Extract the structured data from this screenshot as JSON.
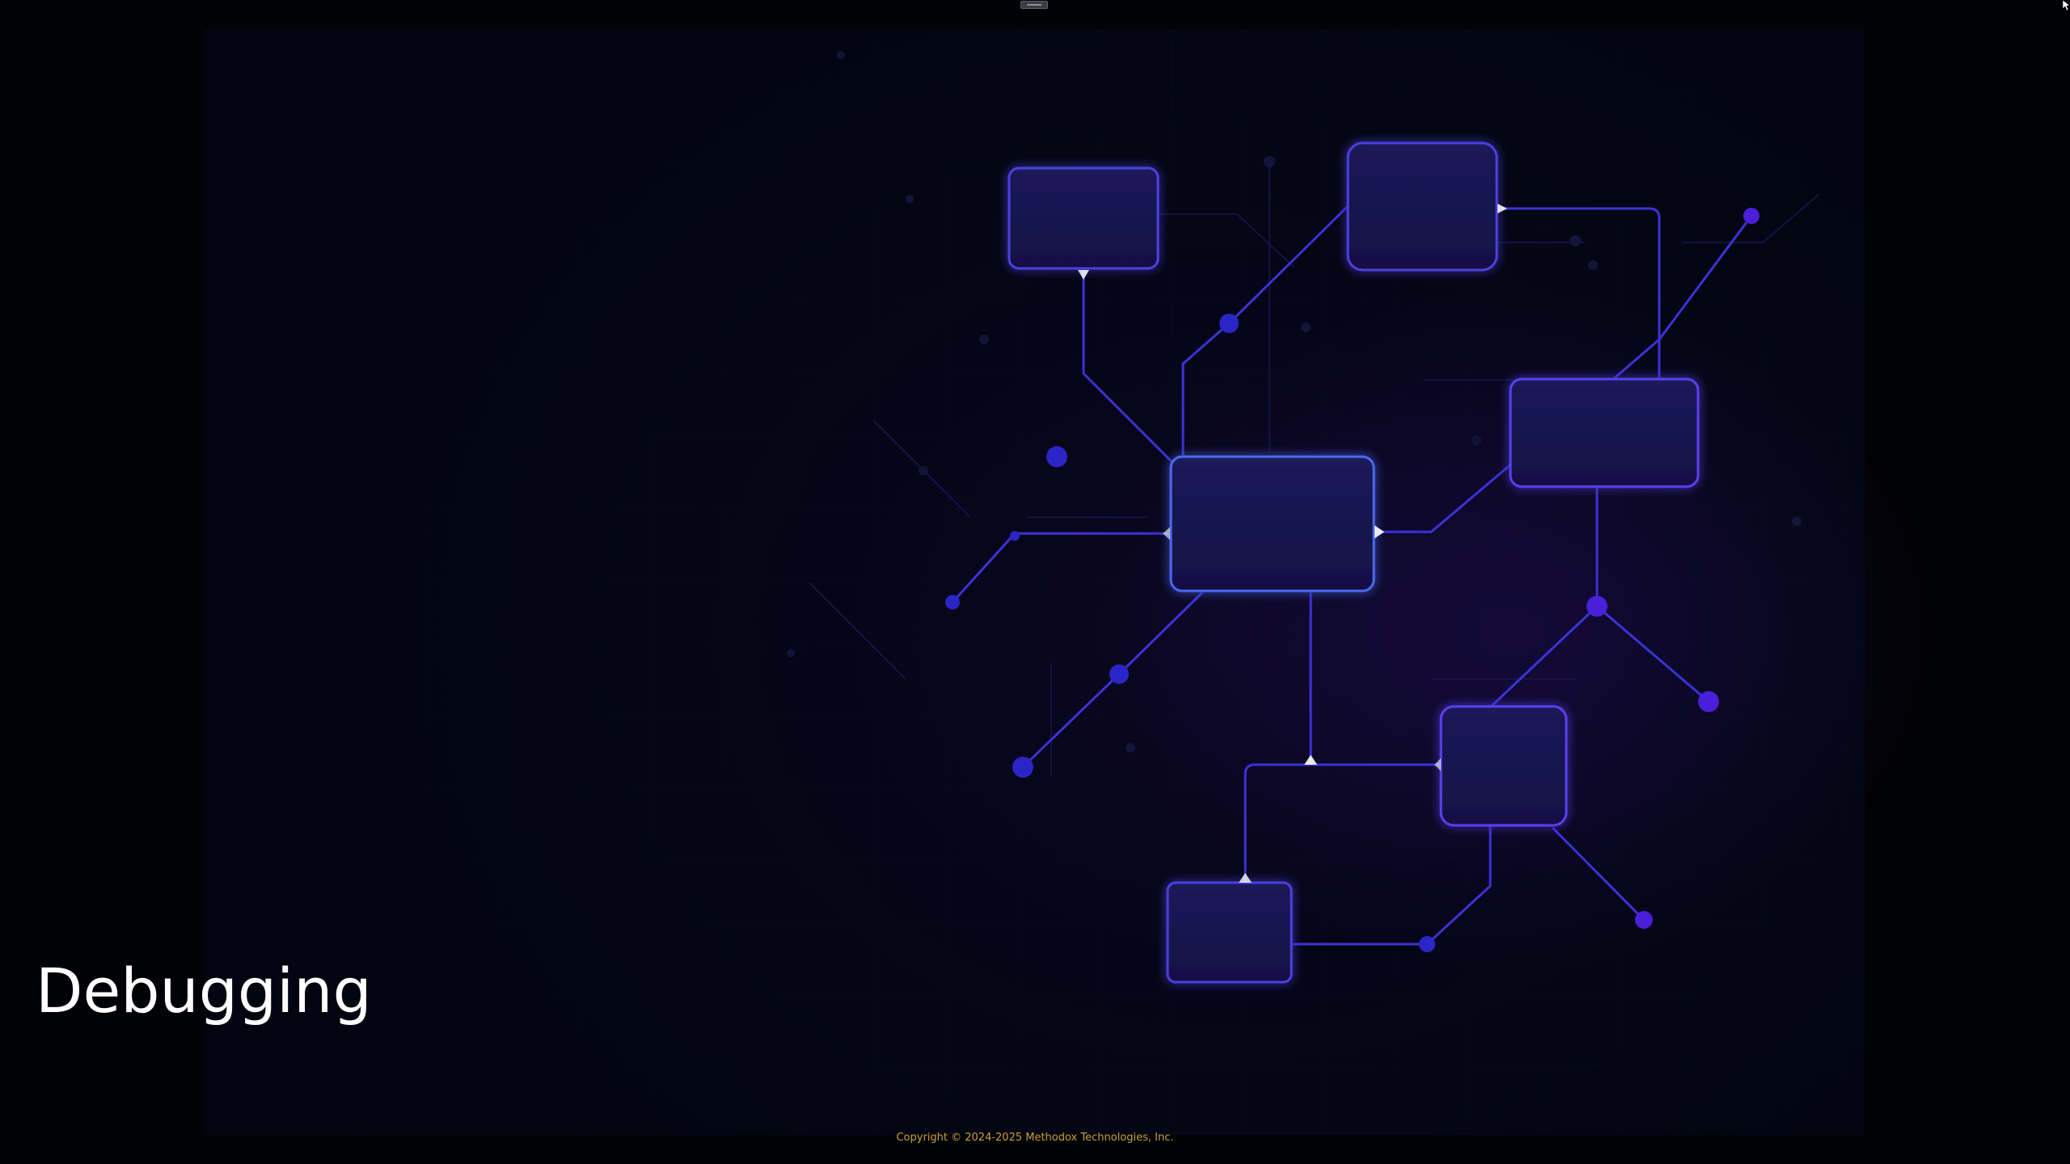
{
  "window": {
    "drag_handle_icon": "drag-handle-icon",
    "cursor_icon": "mouse-pointer-icon"
  },
  "splash": {
    "title": "Debugging",
    "copyright": "Copyright © 2024-2025 Methodox Technologies, Inc."
  },
  "colors": {
    "background": "#010205",
    "panel": "#060518",
    "accent_blue": "#3b32d6",
    "accent_violet": "#4a1fd9",
    "title_text": "#ffffff",
    "copyright_text": "#c7a23a"
  }
}
